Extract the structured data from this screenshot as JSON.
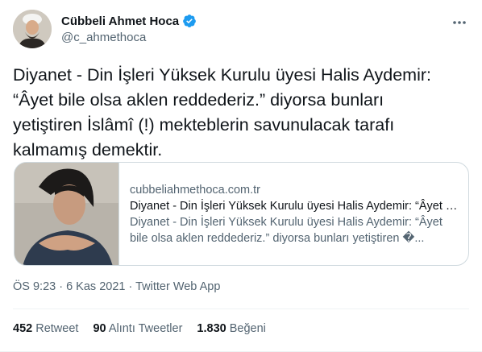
{
  "author": {
    "name": "Cübbeli Ahmet Hoca",
    "handle": "@c_ahmethoca",
    "verified_icon": "verified-badge-icon"
  },
  "tweet": {
    "line1": "Diyanet - Din İşleri Yüksek Kurulu üyesi Halis Aydemir:",
    "line2": "“Âyet bile olsa aklen reddederiz.” diyorsa bunları",
    "line3": "yetiştiren İslâmî (!) mekteblerin savunulacak tarafı",
    "line4": "kalmamış demektir."
  },
  "card": {
    "domain": "cubbeliahmethoca.com.tr",
    "title": "Diyanet - Din İşleri Yüksek Kurulu üyesi Halis Aydemir: “Âyet bile olsa aklen reddederiz.”",
    "desc_line1": "Diyanet - Din İşleri Yüksek Kurulu üyesi Halis Aydemir: “Âyet",
    "desc_line2": "bile olsa aklen reddederiz.” diyorsa bunları yetiştiren �..."
  },
  "meta": {
    "time": "ÖS 9:23",
    "sep1": " · ",
    "date": "6 Kas 2021",
    "sep2": " · ",
    "source": "Twitter Web App"
  },
  "stats": {
    "retweets_count": "452",
    "retweets_label": "Retweet",
    "quotes_count": "90",
    "quotes_label": "Alıntı Tweetler",
    "likes_count": "1.830",
    "likes_label": "Beğeni"
  },
  "colors": {
    "text": "#0f1419",
    "secondary": "#536471",
    "border": "#cfd9de",
    "verified": "#1d9bf0"
  }
}
